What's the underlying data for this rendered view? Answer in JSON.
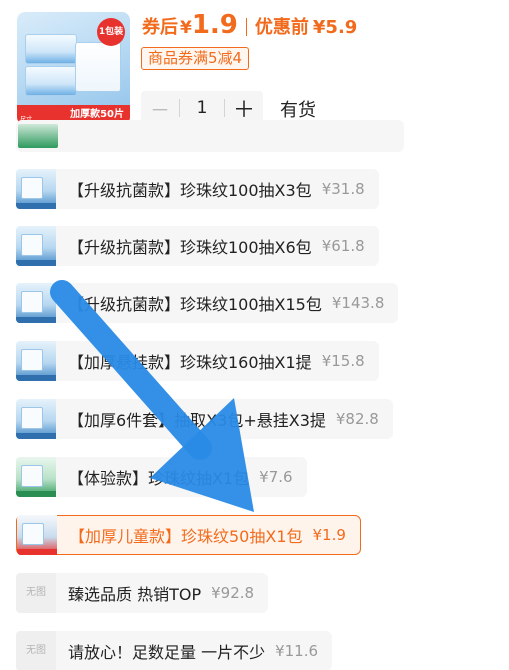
{
  "header": {
    "thumb_badge": "1包装",
    "thumb_bar_label": "加厚款50片",
    "thumb_size_label": "尺寸",
    "coupon_price_label": "券后",
    "currency": "¥",
    "coupon_price": "1.9",
    "original_price_label": "优惠前",
    "original_price": "¥5.9",
    "coupon_tag": "商品券满5减4",
    "quantity": "1",
    "minus_label": "－",
    "plus_label": "＋",
    "stock_status": "有货"
  },
  "options": [
    {
      "name": "【升级抗菌款】珍珠纹100抽X3包",
      "price": "¥31.8",
      "thumb": "blue-pack-icon"
    },
    {
      "name": "【升级抗菌款】珍珠纹100抽X6包",
      "price": "¥61.8",
      "thumb": "blue-pack-icon"
    },
    {
      "name": "【升级抗菌款】珍珠纹100抽X15包",
      "price": "¥143.8",
      "thumb": "blue-pack-icon"
    },
    {
      "name": "【加厚悬挂款】珍珠纹160抽X1提",
      "price": "¥15.8",
      "thumb": "blue-pack-icon"
    },
    {
      "name": "【加厚6件套】抽取X3包+悬挂X3提",
      "price": "¥82.8",
      "thumb": "blue-pack-icon"
    },
    {
      "name": "【体验款】珍珠纹抽X1包",
      "price": "¥7.6",
      "thumb": "green-pack-icon"
    },
    {
      "name": "【加厚儿童款】珍珠纹50抽X1包",
      "price": "¥1.9",
      "thumb": "kid-pack-icon",
      "selected": true
    },
    {
      "name": "臻选品质 热销TOP",
      "price": "¥92.8",
      "thumb": "no-image-icon",
      "noimg_text": "无图"
    },
    {
      "name": "请放心！足数足量 一片不少",
      "price": "¥11.6",
      "thumb": "no-image-icon",
      "noimg_text": "无图"
    }
  ],
  "colors": {
    "accent": "#f26b1d",
    "arrow": "#2a8be6",
    "selected_bg": "#fff4ec"
  }
}
